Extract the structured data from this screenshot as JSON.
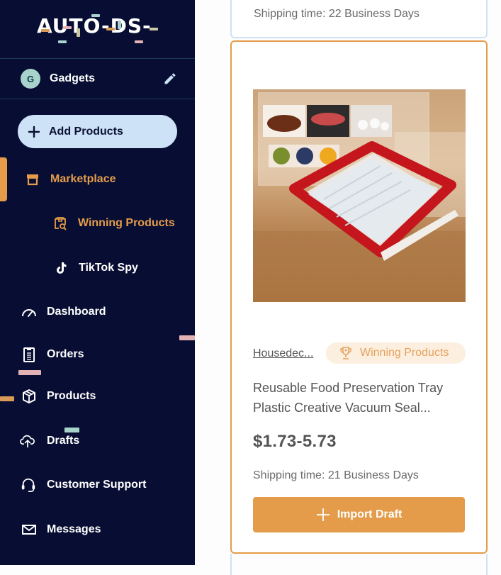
{
  "brand": {
    "logo_text": "AUTO-DS-",
    "accent_colors": {
      "orange": "#e49c4a",
      "pink": "#e2b2b4",
      "teal": "#a7d3cc",
      "olive": "#c9c7a4",
      "navy": "#080e33",
      "light_blue": "#cde1f7"
    }
  },
  "store": {
    "avatar_letter": "G",
    "name": "Gadgets",
    "edit_icon": "pencil-icon"
  },
  "sidebar": {
    "add_button": {
      "label": "Add Products",
      "icon": "plus-icon"
    },
    "items": [
      {
        "label": "Marketplace",
        "icon": "store-icon",
        "active": true,
        "level": 0
      },
      {
        "label": "Winning Products",
        "icon": "box-search-icon",
        "active": true,
        "level": 1
      },
      {
        "label": "TikTok Spy",
        "icon": "tiktok-icon",
        "active": false,
        "level": 1
      },
      {
        "label": "Dashboard",
        "icon": "gauge-icon",
        "active": false,
        "level": 0
      },
      {
        "label": "Orders",
        "icon": "clipboard-icon",
        "active": false,
        "level": 0
      },
      {
        "label": "Products",
        "icon": "box-icon",
        "active": false,
        "level": 0
      },
      {
        "label": "Drafts",
        "icon": "cloud-upload-icon",
        "active": false,
        "level": 0
      },
      {
        "label": "Customer Support",
        "icon": "headset-icon",
        "active": false,
        "level": 0
      },
      {
        "label": "Messages",
        "icon": "envelope-icon",
        "active": false,
        "level": 0
      }
    ]
  },
  "previous_card": {
    "shipping": "Shipping time: 22 Business Days"
  },
  "product_card": {
    "image_alt": "Red and clear reusable food preservation tray in kitchen",
    "supplier": "Housedec...",
    "badge": {
      "label": "Winning Products",
      "icon": "trophy-icon"
    },
    "title": "Reusable Food Preservation Tray Plastic Creative Vacuum Seal...",
    "price": "$1.73-5.73",
    "shipping": "Shipping time: 21 Business Days",
    "import_button": {
      "label": "Import Draft",
      "icon": "plus-icon"
    }
  }
}
